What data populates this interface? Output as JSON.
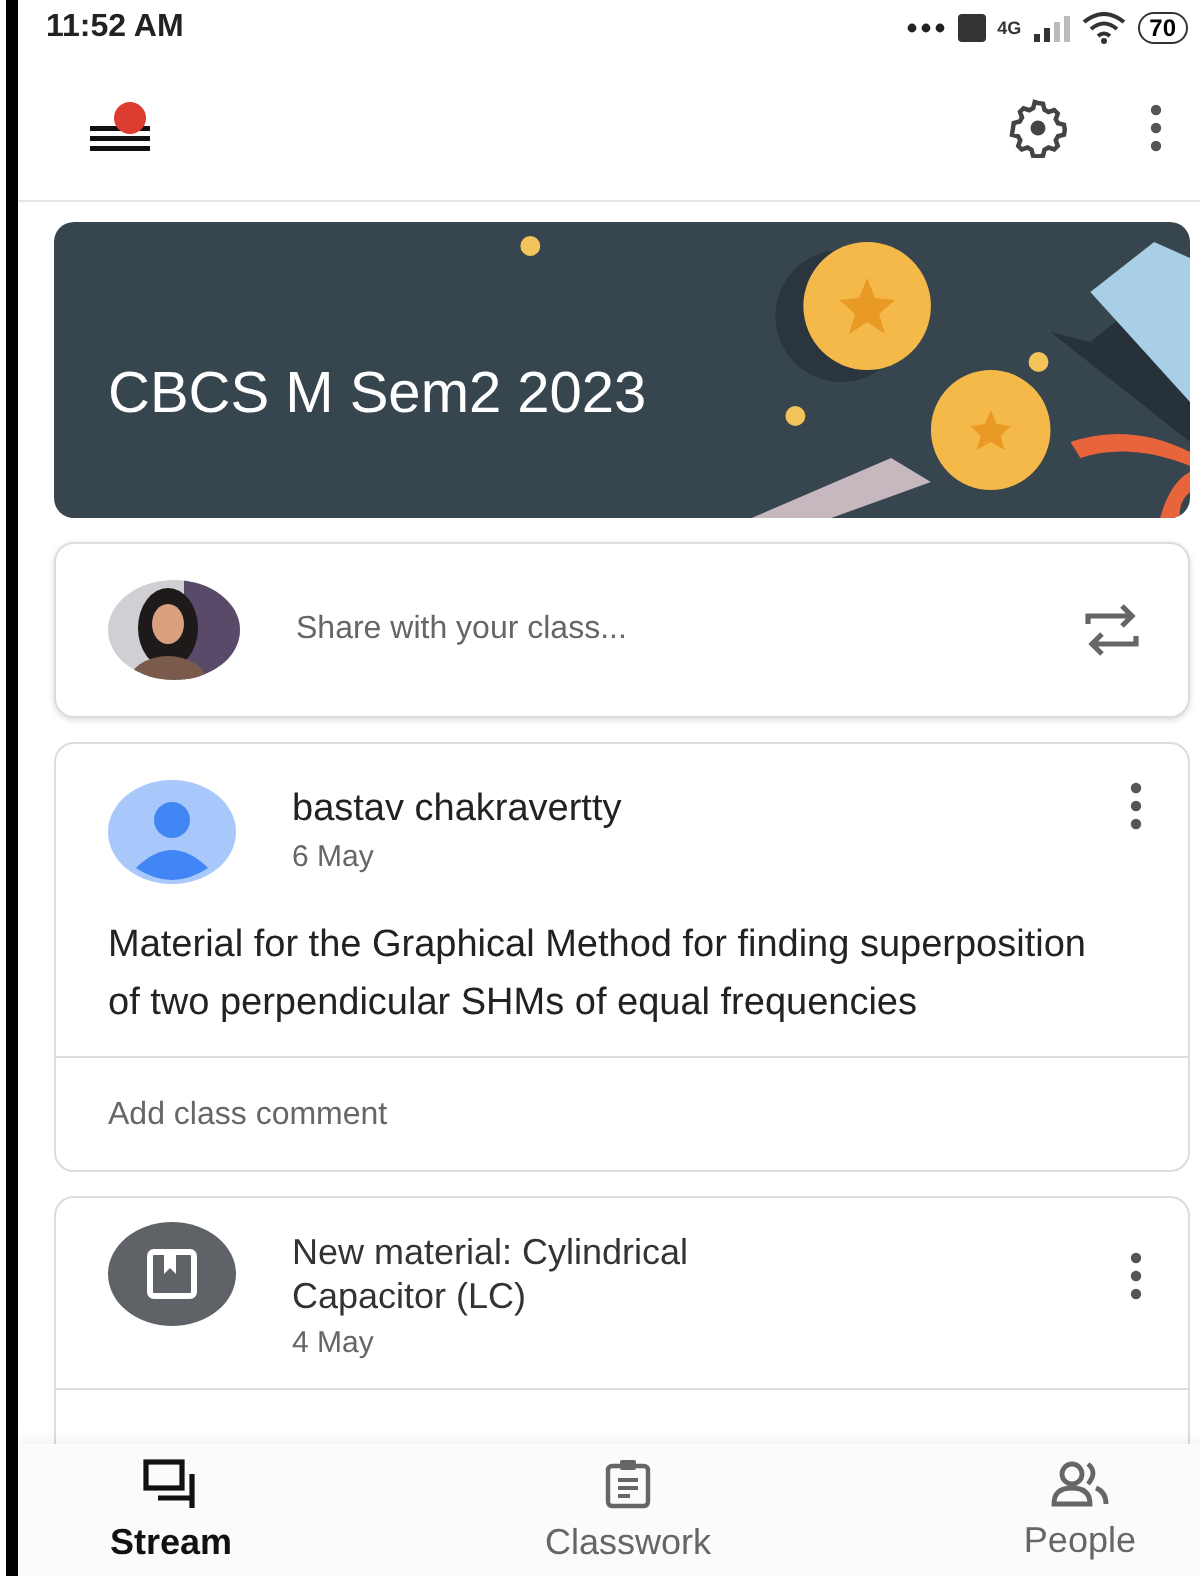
{
  "status_bar": {
    "time": "11:52 AM",
    "network": "4G",
    "battery": "70"
  },
  "banner": {
    "title": "CBCS M Sem2 2023"
  },
  "composer": {
    "placeholder": "Share with your class..."
  },
  "posts": [
    {
      "kind": "announcement",
      "author": "bastav chakravertty",
      "date": "6 May",
      "body": "Material for the Graphical Method for finding superposition of two perpendicular SHMs of equal frequencies",
      "comment_placeholder": "Add class comment"
    },
    {
      "kind": "material",
      "title": "New material: Cylindrical Capacitor (LC)",
      "date": "4 May"
    }
  ],
  "nav": [
    {
      "label": "Stream",
      "selected": true
    },
    {
      "label": "Classwork",
      "selected": false
    },
    {
      "label": "People",
      "selected": false
    }
  ]
}
